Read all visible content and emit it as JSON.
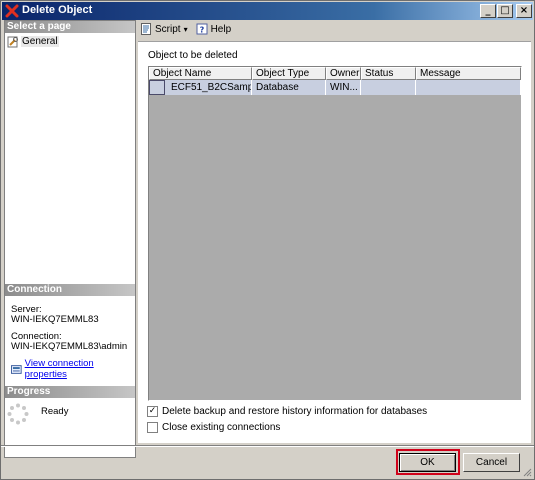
{
  "window": {
    "title": "Delete Object",
    "minimize": "_",
    "maximize": "□",
    "close": "×"
  },
  "left": {
    "select_page_header": "Select a page",
    "pages": [
      {
        "label": "General",
        "icon": "page-wrench-icon"
      }
    ],
    "connection_header": "Connection",
    "server_label": "Server:",
    "server_value": "WIN-IEKQ7EMML83",
    "connection_label": "Connection:",
    "connection_value": "WIN-IEKQ7EMML83\\admin",
    "view_props_link": "View connection properties",
    "progress_header": "Progress",
    "progress_status": "Ready"
  },
  "toolbar": {
    "script_label": "Script",
    "help_label": "Help"
  },
  "main": {
    "group_label": "Object to be deleted",
    "columns": [
      "Object Name",
      "Object Type",
      "Owner",
      "Status",
      "Message"
    ],
    "rows": [
      {
        "object_name": "ECF51_B2CSampl...",
        "object_type": "Database",
        "owner": "WIN...",
        "status": "",
        "message": ""
      }
    ],
    "option_delete_backup": {
      "label": "Delete backup and restore history information for databases",
      "checked": true
    },
    "option_close_connections": {
      "label": "Close existing connections",
      "checked": false
    }
  },
  "buttons": {
    "ok": "OK",
    "cancel": "Cancel"
  },
  "colors": {
    "highlight": "#d0021b",
    "selected_row": "#c8cfe0"
  }
}
